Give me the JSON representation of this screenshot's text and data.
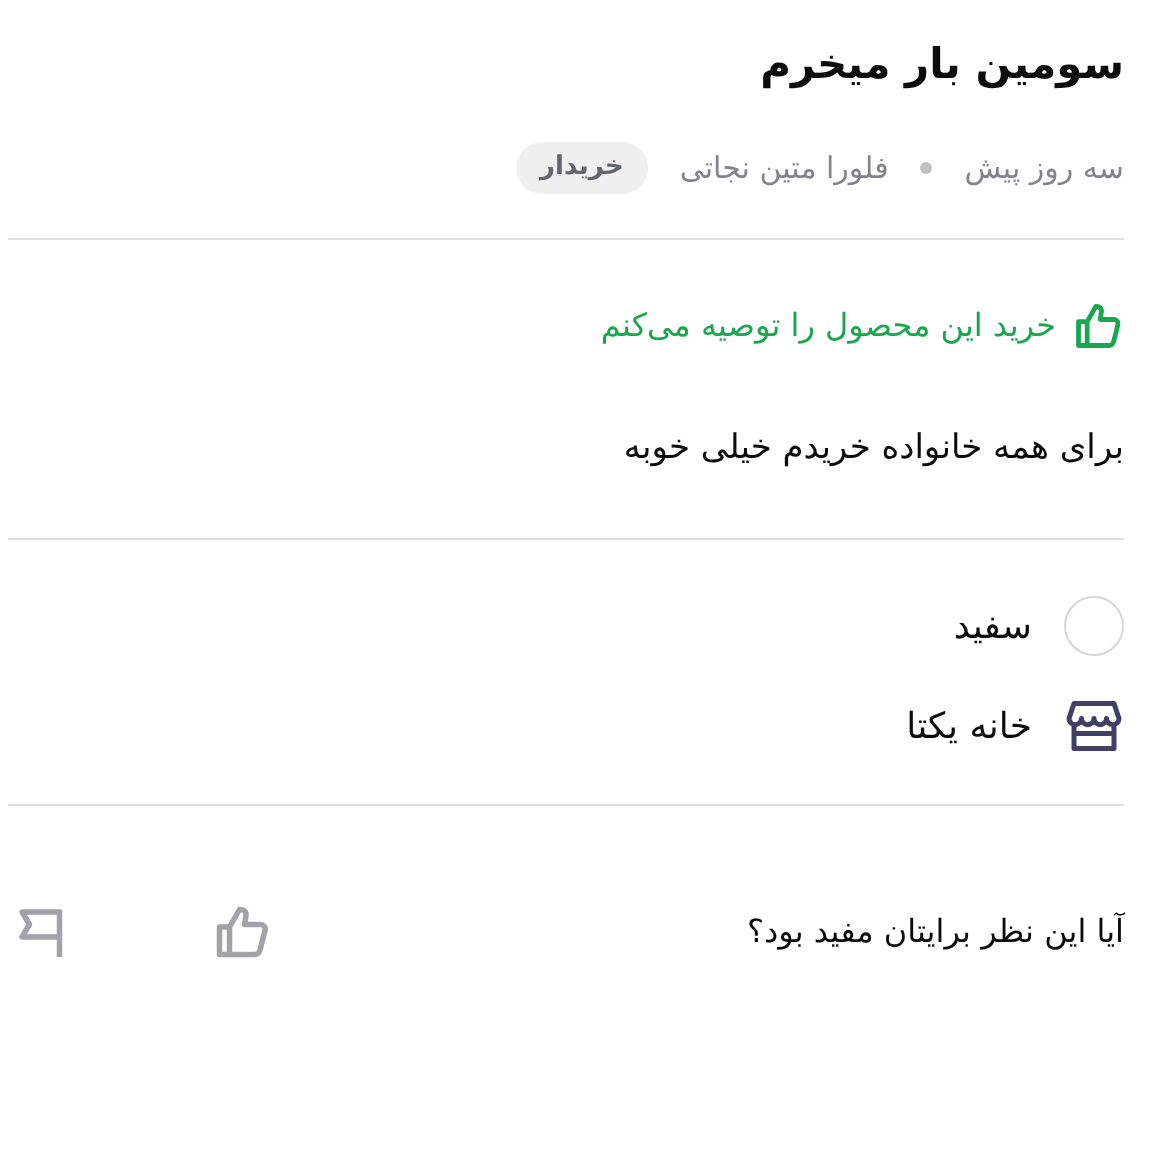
{
  "title": "سومین بار میخرم",
  "meta": {
    "time": "سه روز پیش",
    "author": "فلورا متین نجاتی",
    "badge": "خریدار"
  },
  "recommendation": {
    "text": "خرید این محصول را توصیه می‌کنم",
    "positive": true
  },
  "body": "برای همه خانواده خریدم خیلی خوبه",
  "variant": {
    "color_name": "سفید",
    "color": "#ffffff"
  },
  "seller": {
    "name": "خانه یکتا"
  },
  "footer": {
    "question": "آیا این نظر برایتان مفید بود؟"
  }
}
